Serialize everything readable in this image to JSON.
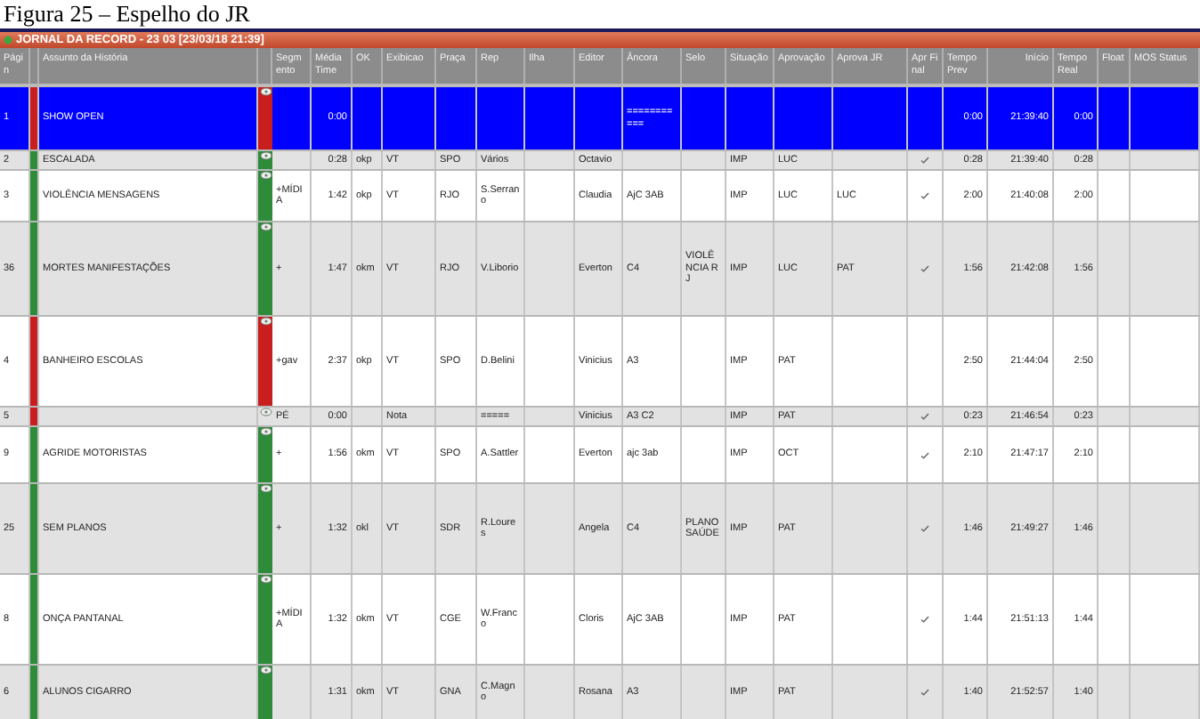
{
  "caption": "Figura 25 – Espelho do JR",
  "window": {
    "title": "JORNAL DA RECORD - 23 03 [23/03/18 21:39]"
  },
  "columns": [
    "Págin",
    "Assunto da História",
    "Segmento",
    "Média Time",
    "OK",
    "Exibicao",
    "Praça",
    "Rep",
    "Ilha",
    "Editor",
    "Âncora",
    "Selo",
    "Situação",
    "Aprovação",
    "Aprova JR",
    "Apr Final",
    "Tempo Prev",
    "Início",
    "Tempo Real",
    "Float",
    "MOS Status"
  ],
  "rows": [
    {
      "page": "1",
      "status_bar": {
        "color": "#c81e1e"
      },
      "subject": "SHOW OPEN",
      "segment_bar": {
        "color": "#c81e1e"
      },
      "media_time": "0:00",
      "ancora": "===========",
      "approved": false,
      "tempo_prev": "0:00",
      "inicio": "21:39:40",
      "tempo_real": "0:00",
      "selected": true
    },
    {
      "page": "2",
      "status_bar": {
        "color": "#2e8b3a"
      },
      "subject": "ESCALADA",
      "segment_bar": {
        "color": "#2e8b3a"
      },
      "media_time": "0:28",
      "ok": "okp",
      "exibicao": "VT",
      "praca": "SPO",
      "rep": "Vários",
      "editor": "Octavio",
      "situacao": "IMP",
      "aprovacao": "LUC",
      "approved": true,
      "tempo_prev": "0:28",
      "inicio": "21:39:40",
      "tempo_real": "0:28",
      "selected": false
    },
    {
      "page": "3",
      "status_bar": {
        "color": "#2e8b3a"
      },
      "subject": "VIOLÊNCIA MENSAGENS",
      "segment_bar": {
        "color": "#2e8b3a"
      },
      "segment": "+MÍDIA",
      "media_time": "1:42",
      "ok": "okp",
      "exibicao": "VT",
      "praca": "RJO",
      "rep": "S.Serrano",
      "editor": "Claudia",
      "ancora": "AjC 3AB",
      "situacao": "IMP",
      "aprovacao": "LUC",
      "aprova_jr": "LUC",
      "approved": true,
      "tempo_prev": "2:00",
      "inicio": "21:40:08",
      "tempo_real": "2:00",
      "selected": false
    },
    {
      "page": "36",
      "status_bar": {
        "color": "#2e8b3a"
      },
      "subject": "MORTES MANIFESTAÇÕES",
      "segment_bar": {
        "color": "#2e8b3a"
      },
      "segment": "+",
      "media_time": "1:47",
      "ok": "okm",
      "exibicao": "VT",
      "praca": "RJO",
      "rep": "V.Liborio",
      "editor": "Everton",
      "ancora": "C4",
      "selo": "VIOLÊNCIA RJ",
      "situacao": "IMP",
      "aprovacao": "LUC",
      "aprova_jr": "PAT",
      "approved": true,
      "tempo_prev": "1:56",
      "inicio": "21:42:08",
      "tempo_real": "1:56",
      "selected": false
    },
    {
      "page": "4",
      "status_bar": {
        "color": "#c81e1e"
      },
      "subject": "BANHEIRO ESCOLAS",
      "segment_bar": {
        "color": "#c81e1e"
      },
      "segment": "+gav",
      "media_time": "2:37",
      "ok": "okp",
      "exibicao": "VT",
      "praca": "SPO",
      "rep": "D.Belini",
      "editor": "Vinicius",
      "ancora": "A3",
      "situacao": "IMP",
      "aprovacao": "PAT",
      "approved": false,
      "tempo_prev": "2:50",
      "inicio": "21:44:04",
      "tempo_real": "2:50",
      "selected": false
    },
    {
      "page": "5",
      "status_bar": {
        "color": "#c81e1e"
      },
      "segment": "PÉ",
      "media_time": "0:00",
      "exibicao": "Nota",
      "rep": "=====",
      "editor": "Vinicius",
      "ancora": "A3 C2",
      "situacao": "IMP",
      "aprovacao": "PAT",
      "approved": true,
      "tempo_prev": "0:23",
      "inicio": "21:46:54",
      "tempo_real": "0:23",
      "selected": false
    },
    {
      "page": "9",
      "status_bar": {
        "color": "#2e8b3a"
      },
      "subject": "AGRIDE MOTORISTAS",
      "segment_bar": {
        "color": "#2e8b3a"
      },
      "segment": "+",
      "media_time": "1:56",
      "ok": "okm",
      "exibicao": "VT",
      "praca": "SPO",
      "rep": "A.Sattler",
      "editor": "Everton",
      "ancora": "ajc 3ab",
      "situacao": "IMP",
      "aprovacao": "OCT",
      "approved": true,
      "tempo_prev": "2:10",
      "inicio": "21:47:17",
      "tempo_real": "2:10",
      "selected": false
    },
    {
      "page": "25",
      "status_bar": {
        "color": "#2e8b3a"
      },
      "subject": "SEM PLANOS",
      "segment_bar": {
        "color": "#2e8b3a"
      },
      "segment": "+",
      "media_time": "1:32",
      "ok": "okl",
      "exibicao": "VT",
      "praca": "SDR",
      "rep": "R.Loures",
      "editor": "Angela",
      "ancora": "C4",
      "selo": "PLANO SAÚDE",
      "situacao": "IMP",
      "aprovacao": "PAT",
      "approved": true,
      "tempo_prev": "1:46",
      "inicio": "21:49:27",
      "tempo_real": "1:46",
      "selected": false
    },
    {
      "page": "8",
      "status_bar": {
        "color": "#2e8b3a"
      },
      "subject": "ONÇA PANTANAL",
      "segment_bar": {
        "color": "#2e8b3a"
      },
      "segment": "+MÍDIA",
      "media_time": "1:32",
      "ok": "okm",
      "exibicao": "VT",
      "praca": "CGE",
      "rep": "W.Franco",
      "editor": "Cloris",
      "ancora": "AjC 3AB",
      "situacao": "IMP",
      "aprovacao": "PAT",
      "approved": true,
      "tempo_prev": "1:44",
      "inicio": "21:51:13",
      "tempo_real": "1:44",
      "selected": false
    },
    {
      "page": "6",
      "status_bar": {
        "color": "#2e8b3a"
      },
      "subject": "ALUNOS CIGARRO",
      "segment_bar": {
        "color": "#2e8b3a"
      },
      "media_time": "1:31",
      "ok": "okm",
      "exibicao": "VT",
      "praca": "GNA",
      "rep": "C.Magno",
      "editor": "Rosana",
      "ancora": "A3",
      "situacao": "IMP",
      "aprovacao": "PAT",
      "approved": true,
      "tempo_prev": "1:40",
      "inicio": "21:52:57",
      "tempo_real": "1:40",
      "selected": false
    }
  ]
}
